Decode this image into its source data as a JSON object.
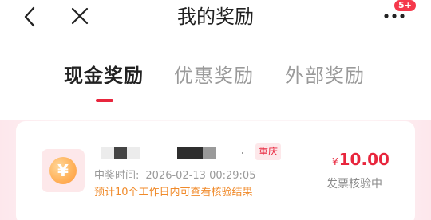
{
  "header": {
    "title": "我的奖励",
    "back_icon": "chevron-left-icon",
    "close_icon": "close-icon",
    "more_icon": "more-dots-icon",
    "badge": "5+",
    "badge_color": "#f5384b"
  },
  "tabs": [
    {
      "label": "现金奖励",
      "active": true
    },
    {
      "label": "优惠奖励",
      "active": false
    },
    {
      "label": "外部奖励",
      "active": false
    }
  ],
  "accent_color": "#e8263d",
  "reward_card": {
    "icon": "yuan-coin-icon",
    "coin_symbol": "¥",
    "city": "重庆",
    "time_label": "中奖时间:",
    "time_value": "2026-02-13 00:29:05",
    "note": "预计10个工作日内可查看核验结果",
    "currency": "¥",
    "amount": "10.00",
    "status": "发票核验中"
  }
}
